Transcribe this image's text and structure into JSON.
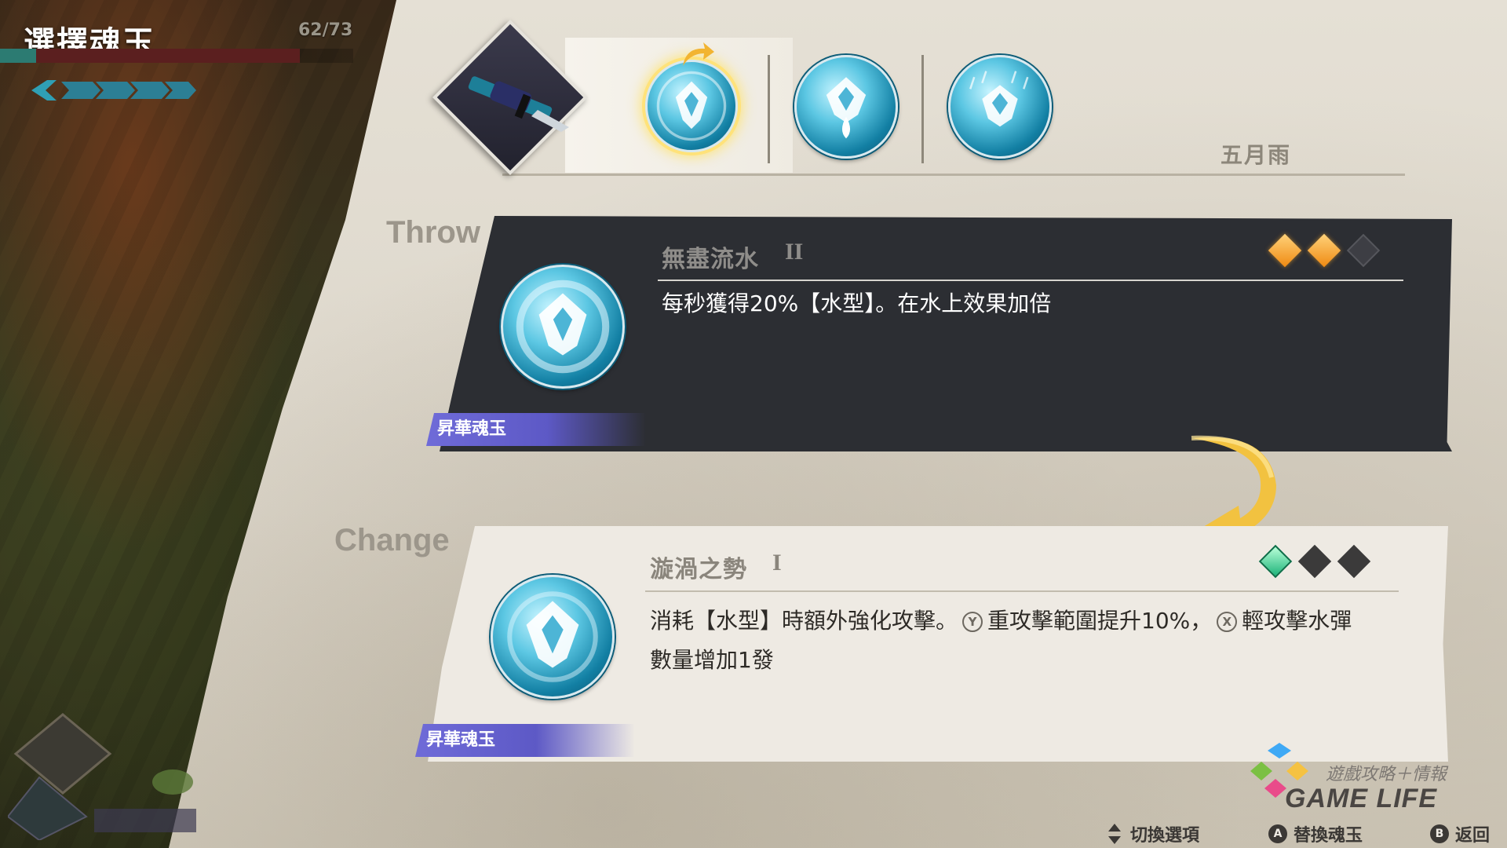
{
  "hud": {
    "title": "選擇魂玉",
    "hp_text": "62/73",
    "hp_fraction": 0.849
  },
  "slots": {
    "slot_name": "五月雨",
    "icons": [
      "sword-weapon-icon",
      "whirlpool-orb-icon",
      "water-drop-orb-icon",
      "rain-orb-icon"
    ]
  },
  "throw": {
    "section_label": "Throw",
    "name": "無盡流水",
    "level": "II",
    "description": "每秒獲得20%【水型】。在水上效果加倍",
    "rarity": "昇華魂玉",
    "gems": [
      "filled",
      "filled",
      "empty"
    ]
  },
  "change": {
    "section_label": "Change",
    "name": "漩渦之勢",
    "level": "I",
    "desc_part1": "消耗【水型】時額外強化攻擊。",
    "btn_y": "Y",
    "desc_part2": "重攻擊範圍提升10%，",
    "btn_x": "X",
    "desc_part3": "輕攻擊水彈數量增加1發",
    "rarity": "昇華魂玉",
    "gems": [
      "filled",
      "empty",
      "empty"
    ]
  },
  "watermark": {
    "sub": "遊戲攻略＋情報",
    "main": "GAME LIFE"
  },
  "controls": {
    "switch_label": "切換選項",
    "replace_btn": "A",
    "replace_label": "替換魂玉",
    "back_btn": "B",
    "back_label": "返回"
  },
  "colors": {
    "gem_orange": "#ef8a12",
    "gem_green": "#1eb47a",
    "rarity_purple": "#6f6bd8",
    "card_dark": "#2c2e33",
    "paper": "#e5e0d5"
  }
}
